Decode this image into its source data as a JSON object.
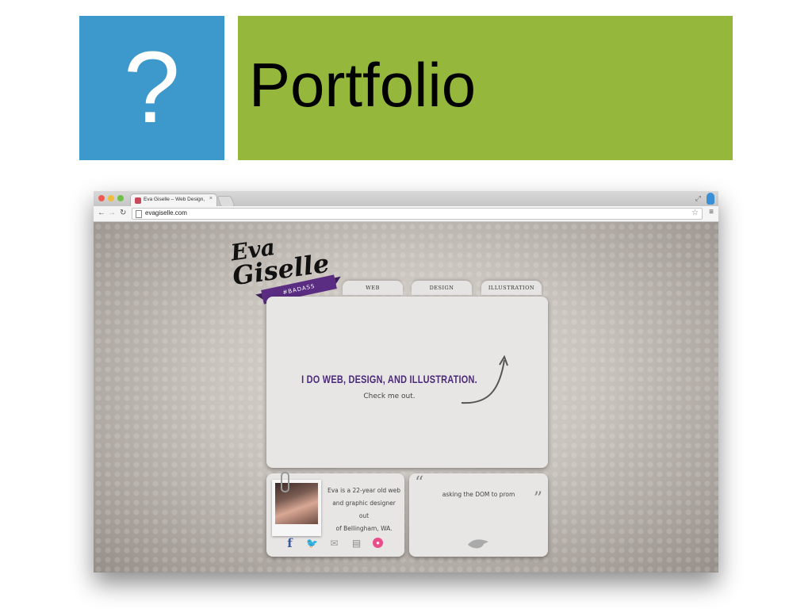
{
  "slide": {
    "icon_glyph": "?",
    "title": "Portfolio",
    "colors": {
      "question_box": "#3d99cb",
      "title_box": "#95b83c"
    }
  },
  "browser": {
    "tab_title": "Eva Giselle – Web Design, Gr",
    "tab_close": "×",
    "url": "evagiselle.com",
    "icons": [
      "back-icon",
      "forward-icon",
      "reload-icon",
      "star-icon",
      "menu-icon",
      "expand-icon",
      "profile-icon"
    ]
  },
  "site": {
    "logo": {
      "line1": "Eva",
      "line2": "Giselle",
      "banner": "#BADASS"
    },
    "nav": [
      "WEB",
      "DESIGN",
      "ILLUSTRATION"
    ],
    "hero": {
      "headline": "I DO WEB, DESIGN, AND ILLUSTRATION.",
      "subtext": "Check me out."
    },
    "bio": {
      "line1": "Eva is a 22-year old web",
      "line2": "and graphic designer out",
      "line3": "of Bellingham, WA."
    },
    "social_icons": [
      "facebook-icon",
      "twitter-icon",
      "mail-icon",
      "document-icon",
      "dribbble-icon"
    ],
    "tweet": {
      "open_quote": "“",
      "text": "asking the DOM to prom",
      "close_quote": "”"
    },
    "colors": {
      "accent_purple": "#5a2d82",
      "headline_purple": "#4b2a7a",
      "card": "#e8e6e5"
    }
  }
}
